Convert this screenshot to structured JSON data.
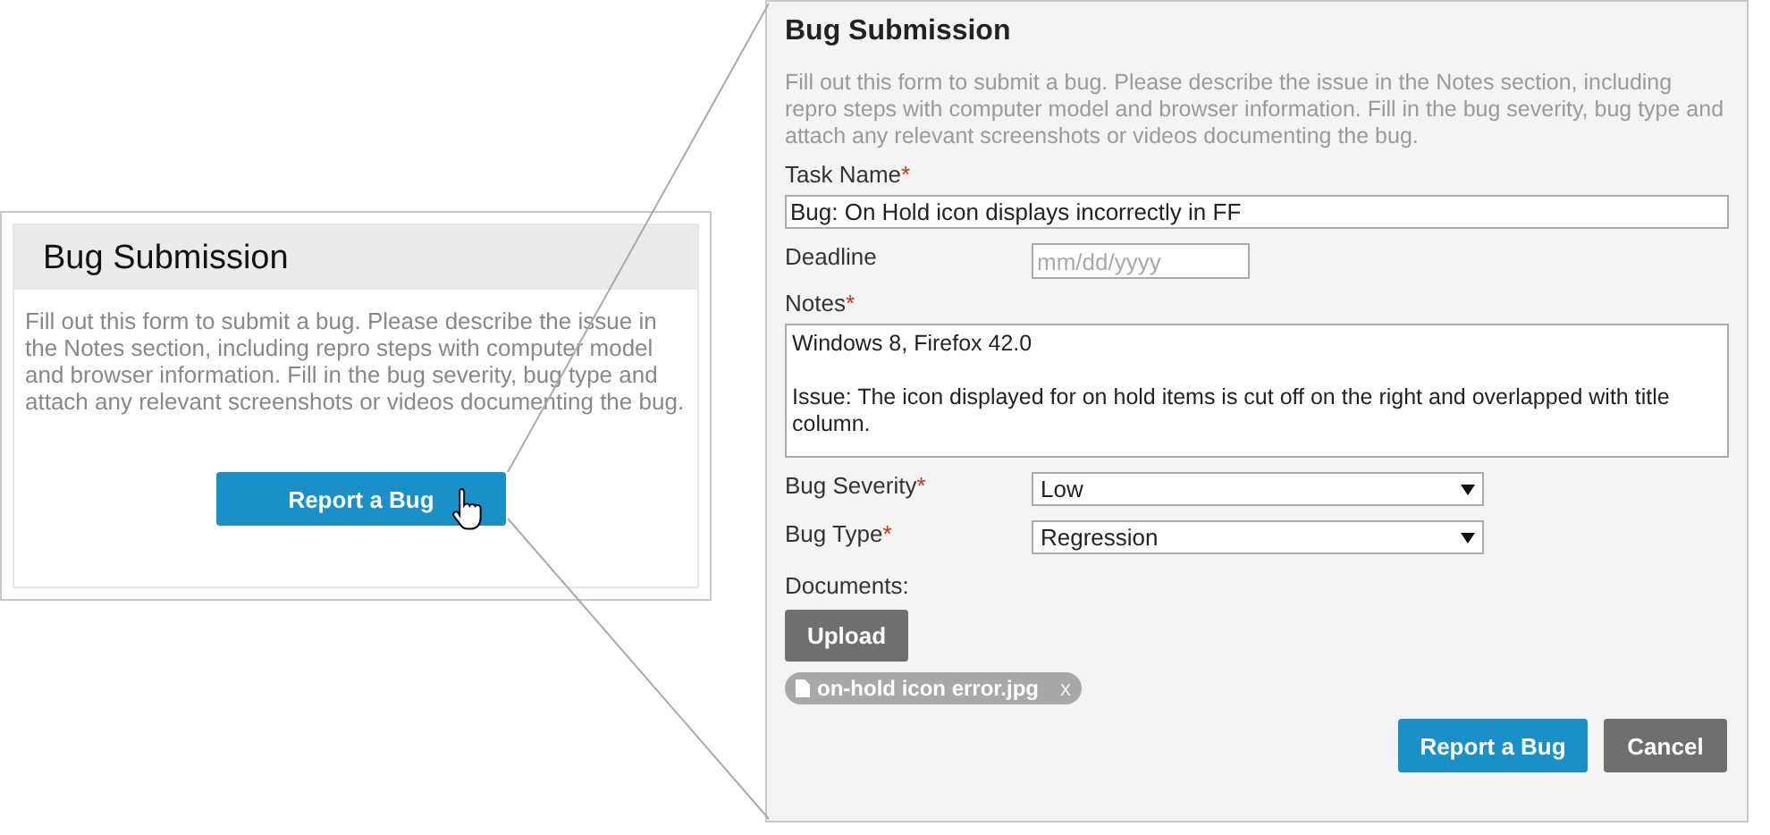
{
  "overview_card": {
    "title": "Bug Submission",
    "description": "Fill out this form to submit a bug. Please describe the issue in the Notes section, including repro steps with computer model and browser information. Fill in the bug severity, bug type and attach any relevant screenshots or videos documenting the bug.",
    "button": "Report a Bug"
  },
  "dialog": {
    "title": "Bug Submission",
    "description": "Fill out this form to submit a bug. Please describe the issue in the Notes section, including repro steps with computer model and browser information. Fill in the bug severity, bug type and attach any relevant screenshots or videos documenting the bug.",
    "fields": [
      {
        "kind": "text",
        "label": "Task Name",
        "required_mark": "*",
        "value": "Bug: On Hold icon displays incorrectly in FF"
      },
      {
        "kind": "date",
        "label": "Deadline",
        "placeholder": "mm/dd/yyyy"
      },
      {
        "kind": "textarea",
        "label": "Notes",
        "required_mark": "*",
        "value": "Windows 8, Firefox 42.0\n\nIssue: The icon displayed for on hold items is cut off on the right and overlapped with title column."
      },
      {
        "kind": "select",
        "label": "Bug Severity",
        "required_mark": "*",
        "value": "Low"
      },
      {
        "kind": "select",
        "label": "Bug Type",
        "required_mark": "*",
        "value": "Regression"
      }
    ],
    "documents": {
      "label": "Documents:",
      "upload_button": "Upload",
      "files": [
        {
          "name": "on-hold icon error.jpg",
          "remove": "x"
        }
      ]
    },
    "buttons": [
      {
        "kind": "primary",
        "label": "Report a Bug"
      },
      {
        "kind": "secondary",
        "label": "Cancel"
      }
    ]
  }
}
